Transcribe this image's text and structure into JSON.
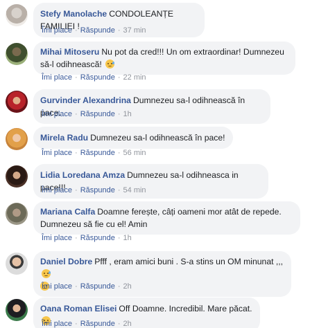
{
  "colors": {
    "author": "#385898",
    "bubble": "#f2f3f5",
    "meta": "#90949c"
  },
  "actions": {
    "like": "Îmi place",
    "reply": "Răspunde",
    "sep": "·"
  },
  "comments": [
    {
      "author": "Stefy Manolache",
      "text": "CONDOLEANȚE FAMILIEI !",
      "time": "37 min",
      "emoji": ""
    },
    {
      "author": "Mihai Mitoseru",
      "text": "Nu pot da cred!!! Un om extraordinar! Dumnezeu",
      "text2": "să-l odihnească!",
      "time": "22 min",
      "emoji": "sad-face-icon"
    },
    {
      "author": "Gurvinder Alexandrina",
      "text": "Dumnezeu sa-l odihnească în pace.",
      "time": "1h",
      "emoji": ""
    },
    {
      "author": "Mirela Radu",
      "text": "Dumnezeu sa-l odihnească în pace!",
      "time": "56 min",
      "emoji": ""
    },
    {
      "author": "Lidia Loredana Amza",
      "text": "Dumnezeu sa-l odihneasca in pace!!!",
      "time": "54 min",
      "emoji": ""
    },
    {
      "author": "Mariana Calfa",
      "text": "Doamne ferește, câți oameni mor atât de repede.",
      "text2": "Dumnezeu să fie cu el! Amin",
      "time": "1h",
      "emoji": ""
    },
    {
      "author": "Daniel Dobre",
      "text": "Pfff , eram amici buni . S-a stins un OM minunat ,,,",
      "time": "2h",
      "emoji": "sad-face-icon"
    },
    {
      "author": "Oana Roman Elisei",
      "text": "Off Doamne. Incredibil. Mare păcat.",
      "time": "2h",
      "emoji": "sad-face-icon"
    }
  ]
}
